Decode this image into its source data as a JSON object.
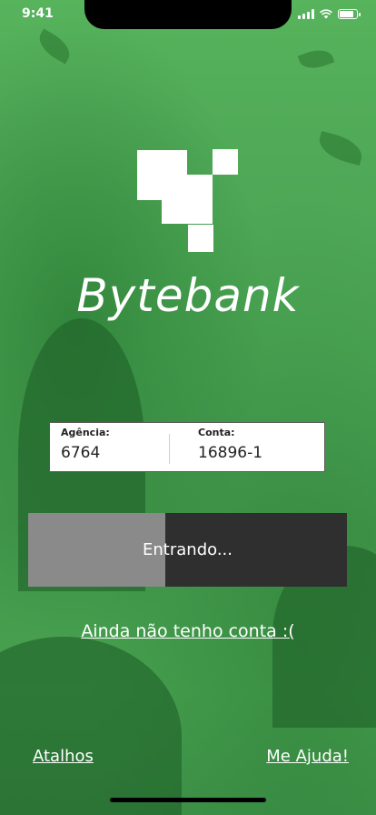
{
  "status_bar": {
    "time": "9:41"
  },
  "brand": {
    "name": "Bytebank"
  },
  "login": {
    "agency_label": "Agência:",
    "agency_value": "6764",
    "account_label": "Conta:",
    "account_value": "16896-1"
  },
  "progress_button": {
    "label": "Entrando...",
    "progress": 0.43
  },
  "links": {
    "signup": "Ainda não tenho conta :(",
    "shortcuts": "Atalhos",
    "help": "Me Ajuda!"
  },
  "colors": {
    "background": "#4aa353",
    "button_dark": "#2f2f2f",
    "button_fill": "#8a8a8a"
  }
}
